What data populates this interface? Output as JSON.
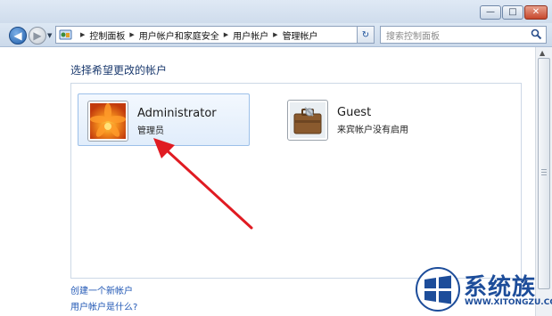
{
  "window": {
    "minimize_label": "—",
    "maximize_label": "□",
    "close_label": "✕"
  },
  "nav": {
    "back_label": "◀",
    "forward_label": "▶",
    "dropdown_label": "▼",
    "breadcrumbs": [
      "控制面板",
      "用户帐户和家庭安全",
      "用户帐户",
      "管理帐户"
    ],
    "refresh_label": "↻",
    "search_placeholder": "搜索控制面板"
  },
  "content": {
    "heading": "选择希望更改的帐户",
    "accounts": [
      {
        "name": "Administrator",
        "role": "管理员",
        "selected": true
      },
      {
        "name": "Guest",
        "role": "来宾帐户没有启用",
        "selected": false
      }
    ],
    "links": {
      "create_account": "创建一个新帐户",
      "what_is_account": "用户帐户是什么?"
    }
  },
  "colors": {
    "arrow": "#e01b22",
    "link": "#1f56b4",
    "heading": "#1c3b6f",
    "watermark": "#1d4d9a"
  },
  "watermark": {
    "brand": "系统族",
    "url": "WWW.XITONGZU.COM"
  }
}
